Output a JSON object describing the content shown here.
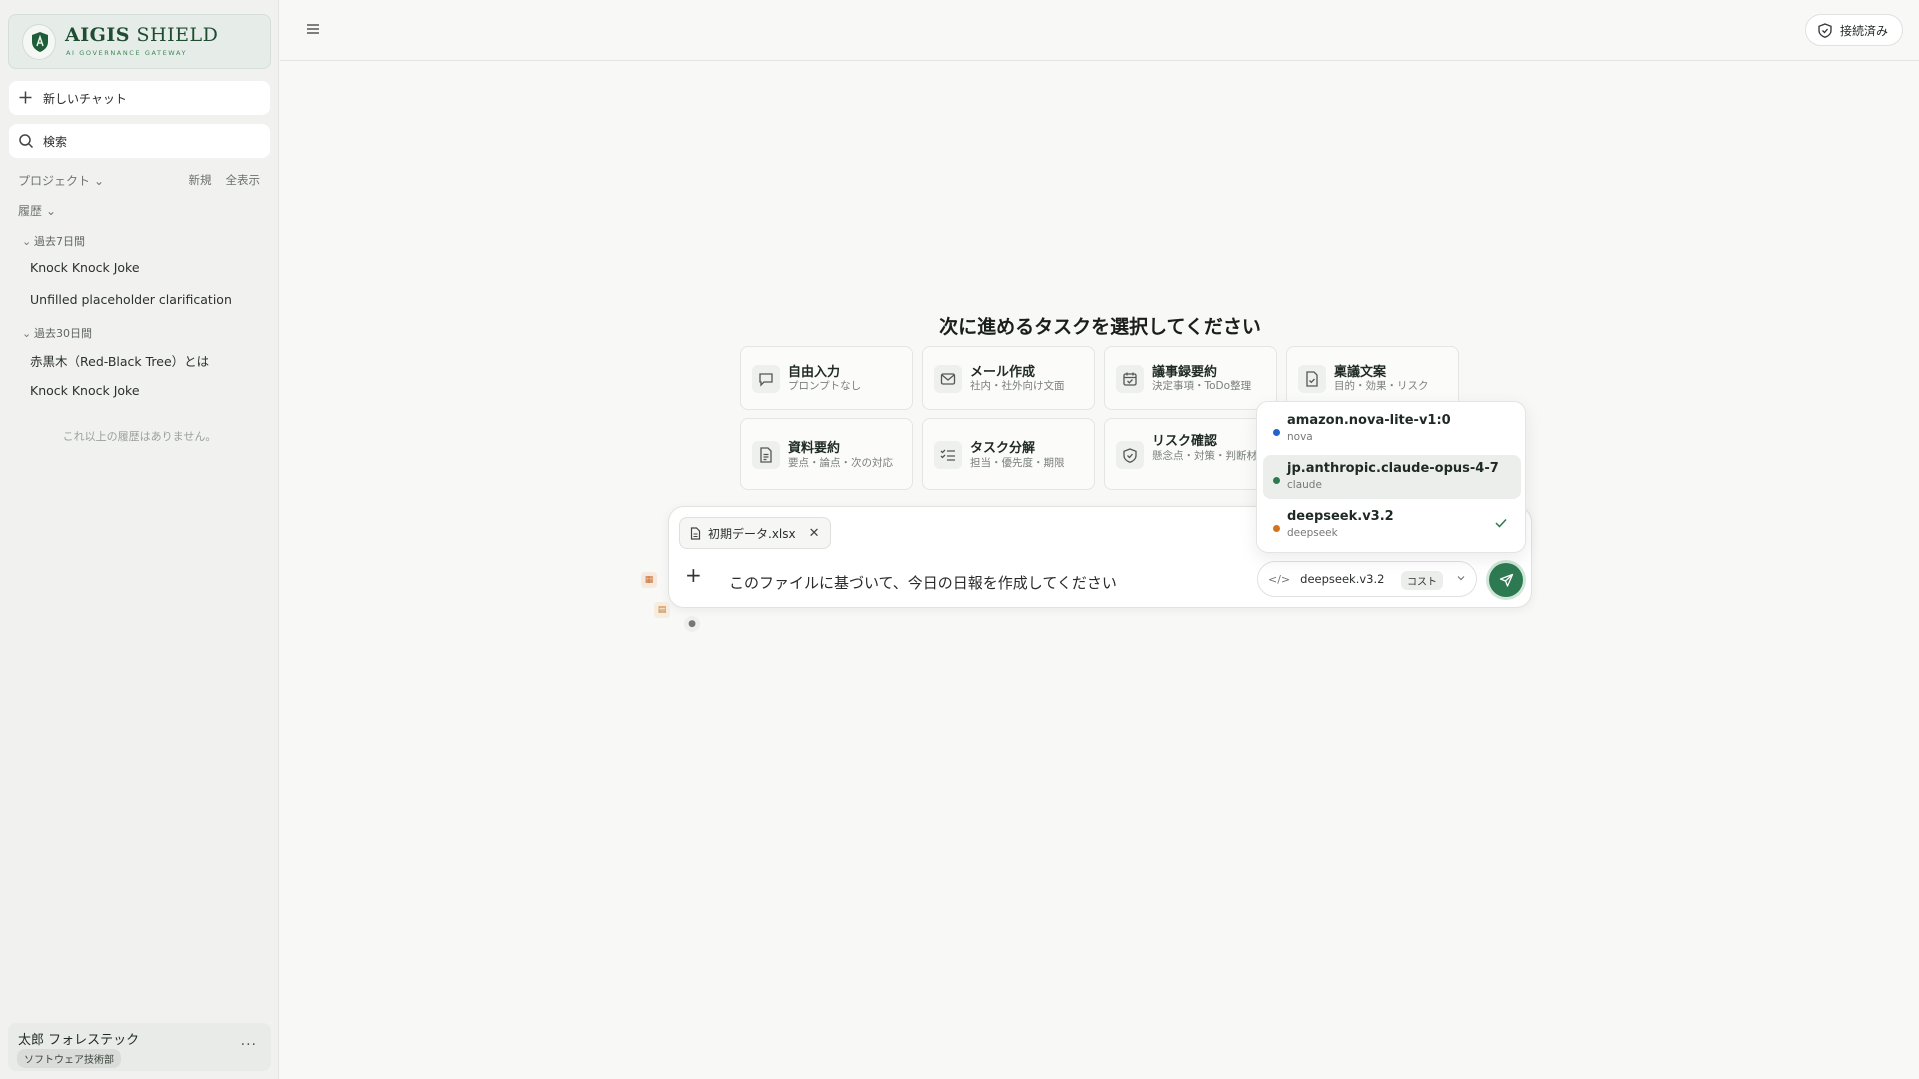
{
  "brand": {
    "title_bold": "AIGIS",
    "title_rest": " SHIELD",
    "subtitle": "AI GOVERNANCE GATEWAY"
  },
  "sidebar": {
    "new_chat": "新しいチャット",
    "search": "検索",
    "projects_label": "プロジェクト",
    "new_link": "新規",
    "show_all_link": "全表示",
    "history_label": "履歴",
    "groups": [
      {
        "label": "過去7日間",
        "items": [
          "Knock Knock Joke",
          "Unfilled placeholder clarification"
        ]
      },
      {
        "label": "過去30日間",
        "items": [
          "赤黒木（Red-Black Tree）とは",
          "Knock Knock Joke"
        ]
      }
    ],
    "no_more": "これ以上の履歴はありません。",
    "user": {
      "name": "太郎 フォレステック",
      "dept": "ソフトウェア技術部"
    }
  },
  "topbar": {
    "status": "接続済み"
  },
  "main": {
    "heading": "次に進めるタスクを選択してください",
    "cards": [
      {
        "title": "自由入力",
        "sub": "プロンプトなし",
        "icon": "chat-bubble-icon"
      },
      {
        "title": "メール作成",
        "sub": "社内・社外向け文面",
        "icon": "mail-icon"
      },
      {
        "title": "議事録要約",
        "sub": "決定事項・ToDo整理",
        "icon": "calendar-check-icon"
      },
      {
        "title": "稟議文案",
        "sub": "目的・効果・リスク",
        "icon": "document-check-icon"
      },
      {
        "title": "資料要約",
        "sub": "要点・論点・次の対応",
        "icon": "document-text-icon"
      },
      {
        "title": "タスク分解",
        "sub": "担当・優先度・期限",
        "icon": "checklist-icon"
      },
      {
        "title": "リスク確認",
        "sub": "懸念点・対策・判断材料",
        "icon": "shield-check-icon"
      }
    ],
    "composer": {
      "attachment": "初期データ.xlsx",
      "prompt": "このファイルに基づいて、今日の日報を作成してください",
      "model": "deepseek.v3.2",
      "cost_badge": "コスト"
    },
    "model_menu": [
      {
        "name": "amazon.nova-lite-v1:0",
        "provider": "nova",
        "color": "#2563c9",
        "selected": false
      },
      {
        "name": "jp.anthropic.claude-opus-4-7",
        "provider": "claude",
        "color": "#2d7a52",
        "selected": false
      },
      {
        "name": "deepseek.v3.2",
        "provider": "deepseek",
        "color": "#d2731f",
        "selected": true
      }
    ]
  }
}
